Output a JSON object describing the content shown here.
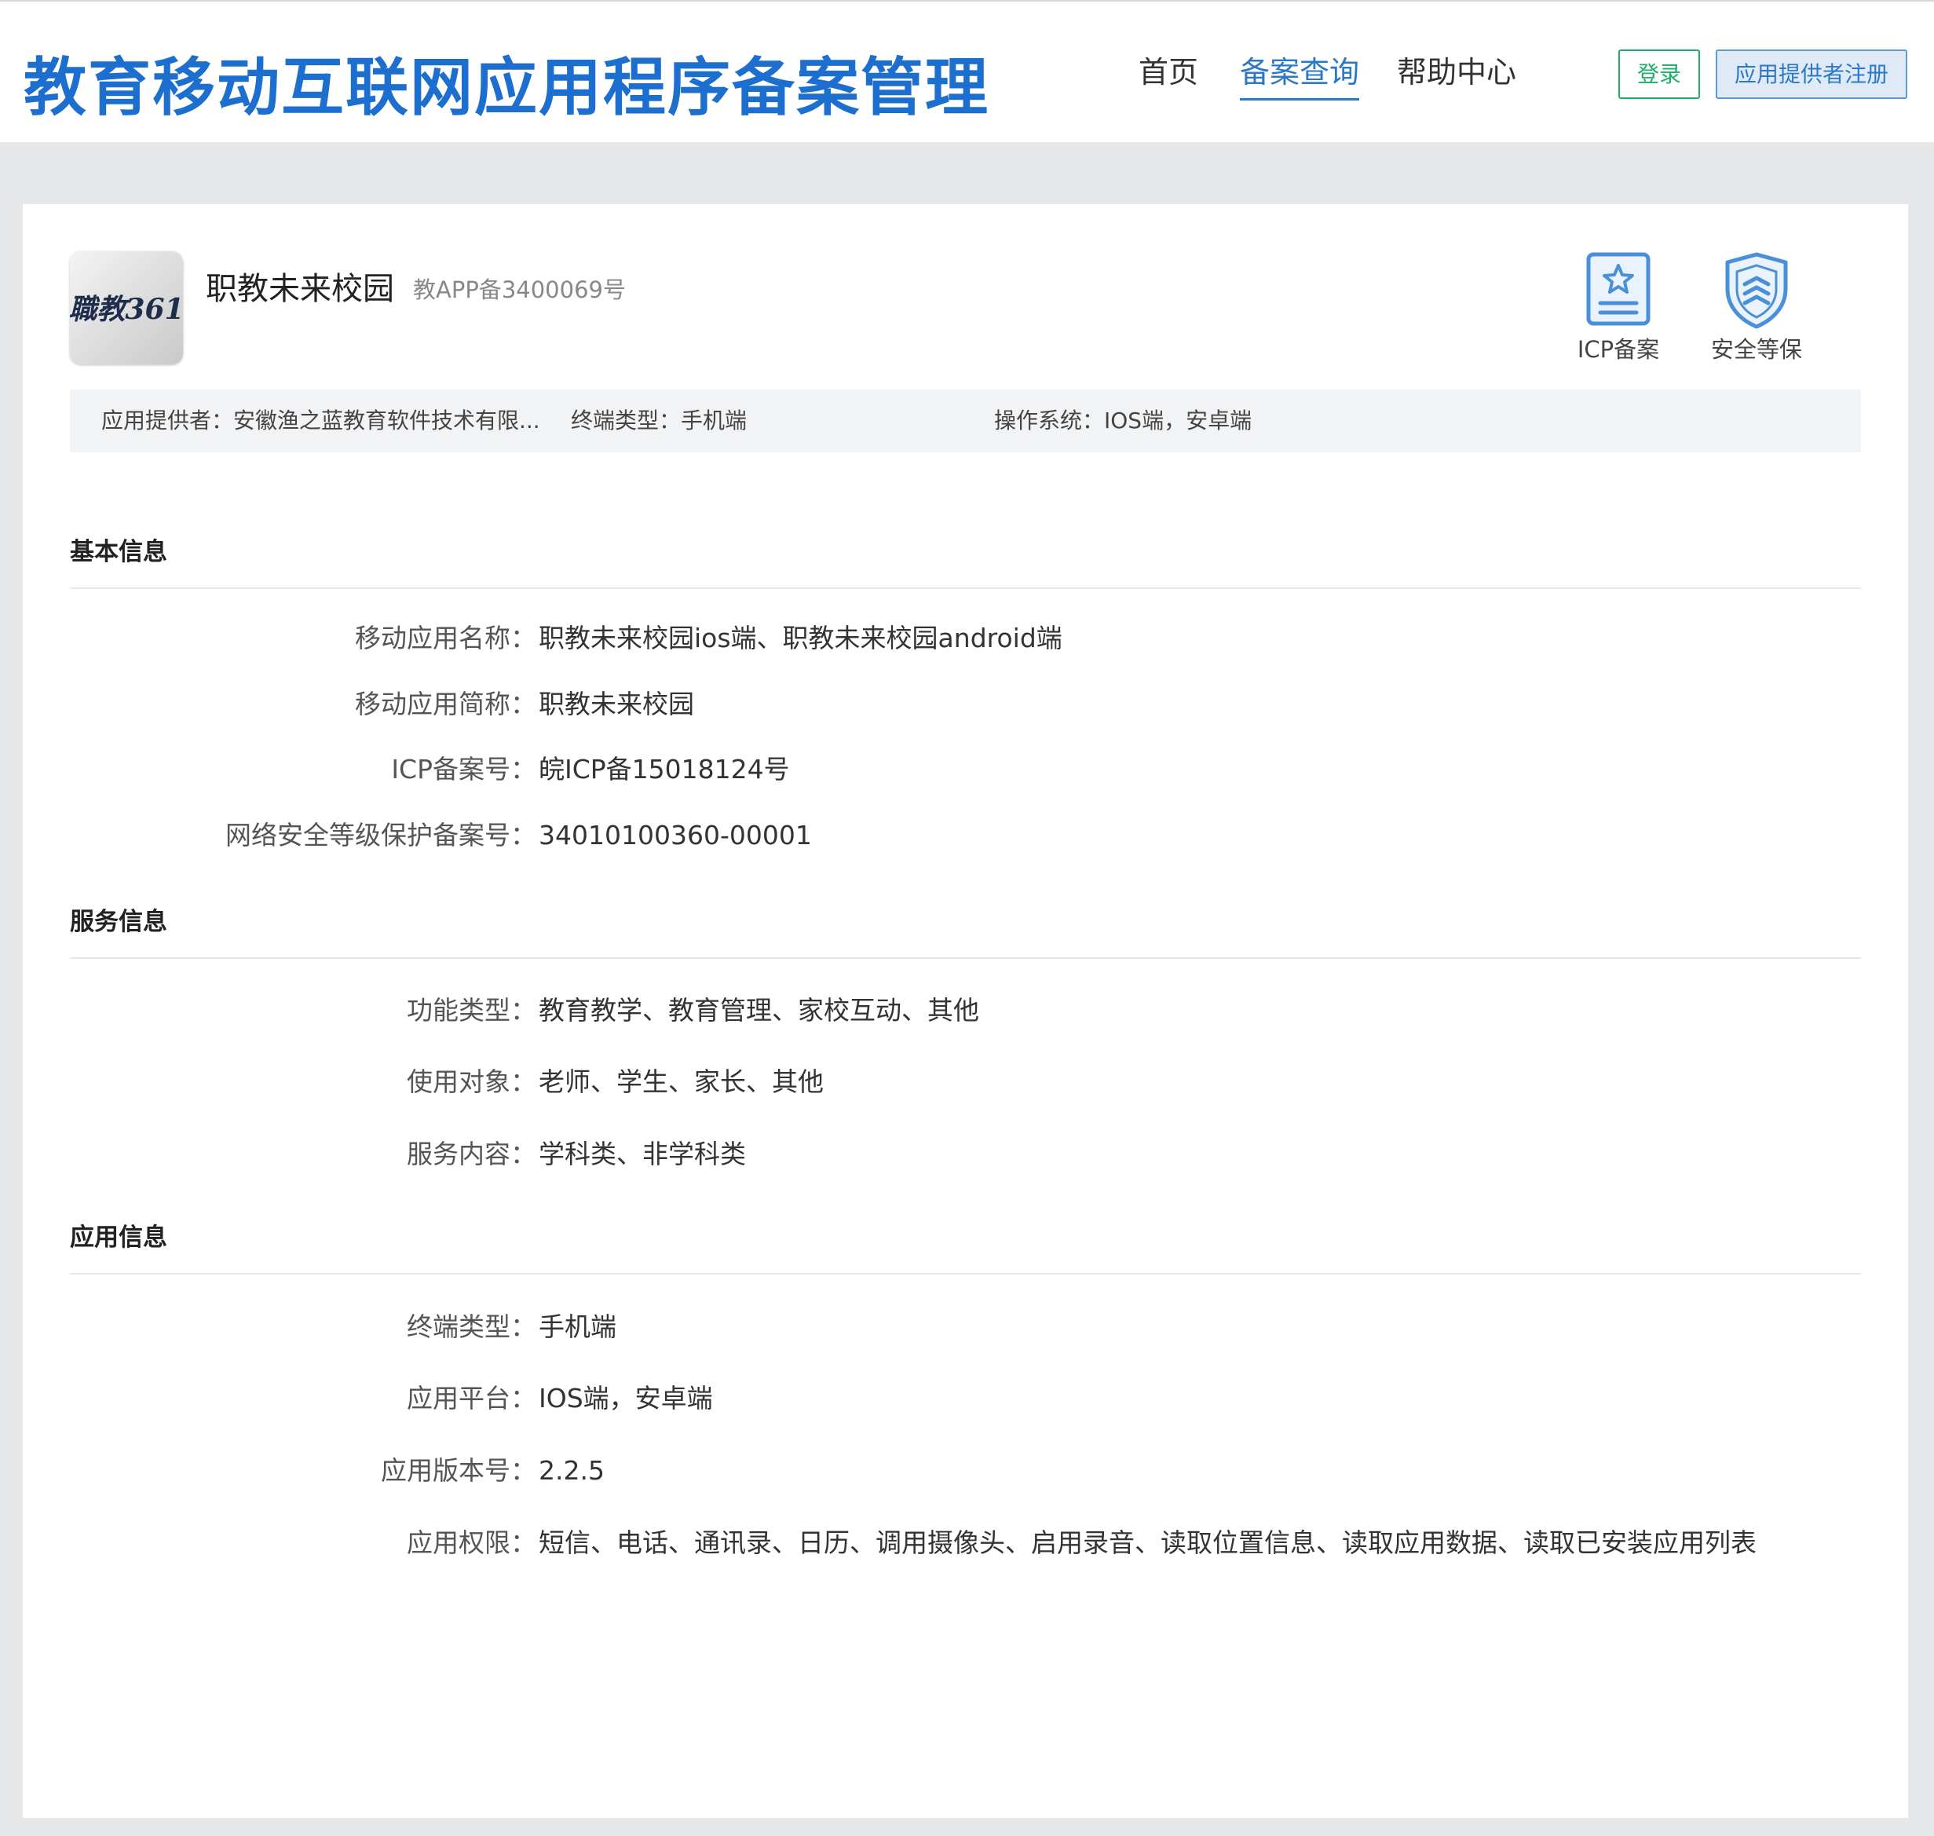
{
  "header": {
    "site_title": "教育移动互联网应用程序备案管理",
    "nav": [
      {
        "label": "首页"
      },
      {
        "label": "备案查询",
        "active": true
      },
      {
        "label": "帮助中心"
      }
    ],
    "login_label": "登录",
    "register_label": "应用提供者注册"
  },
  "app": {
    "icon_text": "職教361",
    "name": "职教未来校园",
    "record_code": "教APP备3400069号",
    "badges": [
      {
        "label": "ICP备案",
        "icon": "certificate-star-icon"
      },
      {
        "label": "安全等保",
        "icon": "shield-icon"
      }
    ],
    "summary": {
      "provider": "应用提供者：安徽渔之蓝教育软件技术有限...",
      "terminal": "终端类型：手机端",
      "os": "操作系统：IOS端，安卓端"
    }
  },
  "sections": {
    "basic": {
      "title": "基本信息",
      "rows": [
        {
          "label": "移动应用名称：",
          "value": "职教未来校园ios端、职教未来校园android端"
        },
        {
          "label": "移动应用简称：",
          "value": "职教未来校园"
        },
        {
          "label": "ICP备案号：",
          "value": "皖ICP备15018124号"
        },
        {
          "label": "网络安全等级保护备案号：",
          "value": "34010100360-00001"
        }
      ]
    },
    "service": {
      "title": "服务信息",
      "rows": [
        {
          "label": "功能类型：",
          "value": "教育教学、教育管理、家校互动、其他"
        },
        {
          "label": "使用对象：",
          "value": "老师、学生、家长、其他"
        },
        {
          "label": "服务内容：",
          "value": "学科类、非学科类"
        }
      ]
    },
    "appinfo": {
      "title": "应用信息",
      "rows": [
        {
          "label": "终端类型：",
          "value": "手机端"
        },
        {
          "label": "应用平台：",
          "value": "IOS端，安卓端"
        },
        {
          "label": "应用版本号：",
          "value": "2.2.5"
        },
        {
          "label": "应用权限：",
          "value": "短信、电话、通讯录、日历、调用摄像头、启用录音、读取位置信息、读取应用数据、读取已安装应用列表"
        }
      ]
    }
  },
  "colors": {
    "brand_blue": "#1d6fcf",
    "nav_active": "#2b78c9",
    "login_green": "#1fae6b"
  }
}
